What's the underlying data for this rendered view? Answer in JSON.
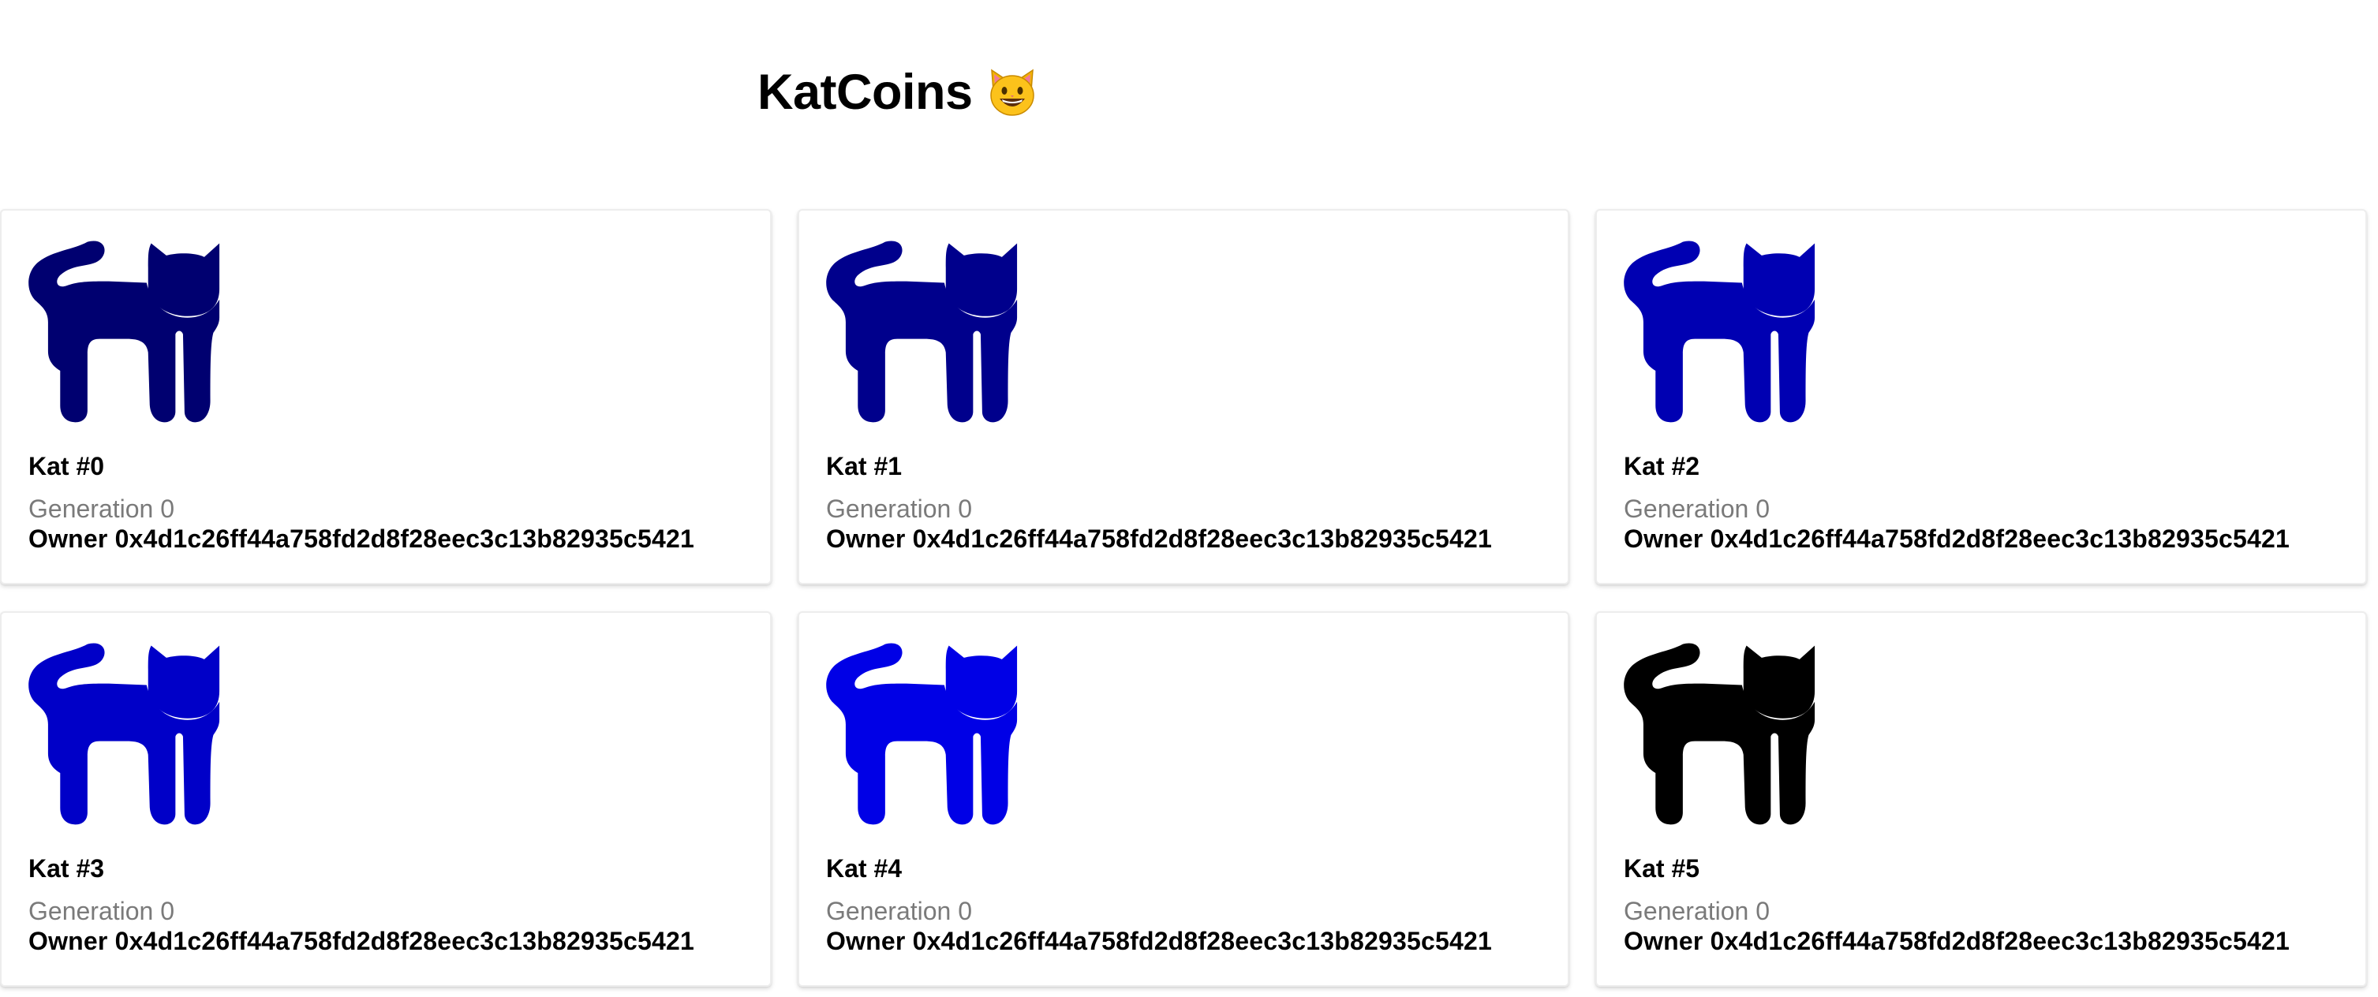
{
  "header": {
    "title": "KatCoins",
    "emoji_icon": "grinning-cat-face-icon"
  },
  "cards": [
    {
      "name": "Kat #0",
      "generation": "Generation 0",
      "owner": "Owner 0x4d1c26ff44a758fd2d8f28eec3c13b82935c5421",
      "color": "#000070"
    },
    {
      "name": "Kat #1",
      "generation": "Generation 0",
      "owner": "Owner 0x4d1c26ff44a758fd2d8f28eec3c13b82935c5421",
      "color": "#00008c"
    },
    {
      "name": "Kat #2",
      "generation": "Generation 0",
      "owner": "Owner 0x4d1c26ff44a758fd2d8f28eec3c13b82935c5421",
      "color": "#0000b2"
    },
    {
      "name": "Kat #3",
      "generation": "Generation 0",
      "owner": "Owner 0x4d1c26ff44a758fd2d8f28eec3c13b82935c5421",
      "color": "#0000c8"
    },
    {
      "name": "Kat #4",
      "generation": "Generation 0",
      "owner": "Owner 0x4d1c26ff44a758fd2d8f28eec3c13b82935c5421",
      "color": "#0000e6"
    },
    {
      "name": "Kat #5",
      "generation": "Generation 0",
      "owner": "Owner 0x4d1c26ff44a758fd2d8f28eec3c13b82935c5421",
      "color": "#000000"
    }
  ]
}
